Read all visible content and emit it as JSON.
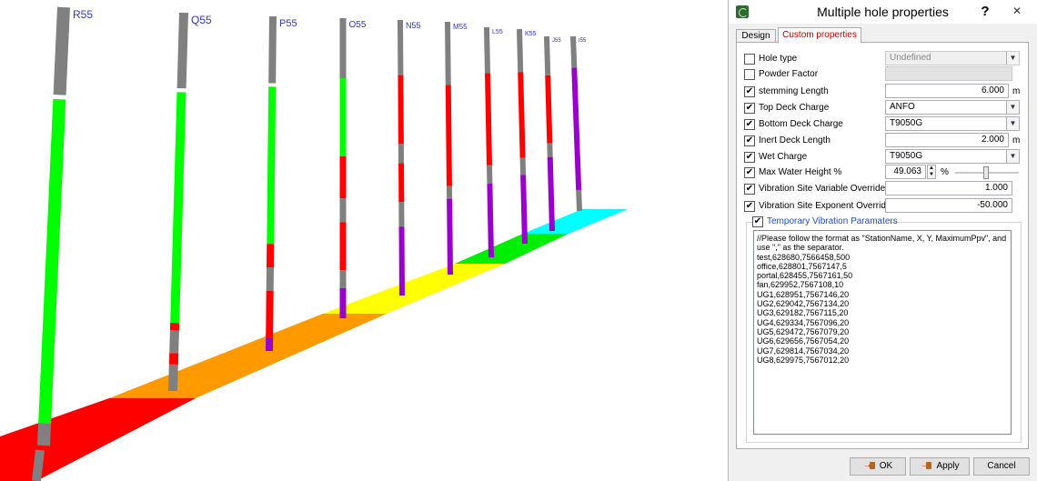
{
  "viewport": {
    "hole_labels": [
      "R55",
      "Q55",
      "P55",
      "O55",
      "N55",
      "M55",
      "L55",
      "K55",
      "J55",
      "I55"
    ],
    "colors": {
      "collar": "#808080",
      "stemming": "#00ff00",
      "charge": "#ff0000",
      "wet_charge": "#9900cc",
      "zone_red": "#ff0000",
      "zone_orange": "#ff9900",
      "zone_yellow": "#ffff00",
      "zone_green": "#00ee00",
      "zone_cyan": "#00ffff",
      "label": "#3333cc"
    }
  },
  "dialog": {
    "title": "Multiple hole properties",
    "help": "?",
    "close": "✕",
    "tabs": [
      {
        "label": "Design",
        "active": false
      },
      {
        "label": "Custom properties",
        "active": true
      }
    ],
    "fields": {
      "hole_type": {
        "label": "Hole type",
        "checked": false,
        "value": "Undefined"
      },
      "powder_factor": {
        "label": "Powder Factor",
        "checked": false,
        "value": ""
      },
      "stemming_length": {
        "label": "stemming Length",
        "checked": true,
        "value": "6.000",
        "unit": "m"
      },
      "top_deck_charge": {
        "label": "Top Deck Charge",
        "checked": true,
        "value": "ANFO"
      },
      "bottom_deck_charge": {
        "label": "Bottom Deck Charge",
        "checked": true,
        "value": "T9050G"
      },
      "inert_deck_length": {
        "label": "Inert Deck Length",
        "checked": true,
        "value": "2.000",
        "unit": "m"
      },
      "wet_charge": {
        "label": "Wet Charge",
        "checked": true,
        "value": "T9050G"
      },
      "max_water_height": {
        "label": "Max Water Height %",
        "checked": true,
        "value": "49.063",
        "unit": "%",
        "slider_level": 0.49
      },
      "vib_variable": {
        "label": "Vibration Site Variable Override",
        "checked": true,
        "value": "1.000"
      },
      "vib_exponent": {
        "label": "Vibration Site Exponent Override",
        "checked": true,
        "value": "-50.000"
      }
    },
    "temp_vibration": {
      "label": "Temporary Vibration Paramaters",
      "checked": true,
      "text": "//Please follow the format as \"StationName, X, Y, MaximumPpv\", and use \",\" as the separator.\ntest,628680,7566458,500\noffice,628801,7567147,5\nportal,628455,7567161,50\nfan,629952,7567108,10\nUG1,628951,7567146,20\nUG2,629042,7567134,20\nUG3,629182,7567115,20\nUG4,629334,7567096,20\nUG5,629472,7567079,20\nUG6,629656,7567054,20\nUG7,629814,7567034,20\nUG8,629975,7567012,20"
    },
    "buttons": {
      "ok": "OK",
      "apply": "Apply",
      "cancel": "Cancel"
    },
    "icons": {
      "check": "✔",
      "dropdown": "chevron-down-icon"
    }
  }
}
